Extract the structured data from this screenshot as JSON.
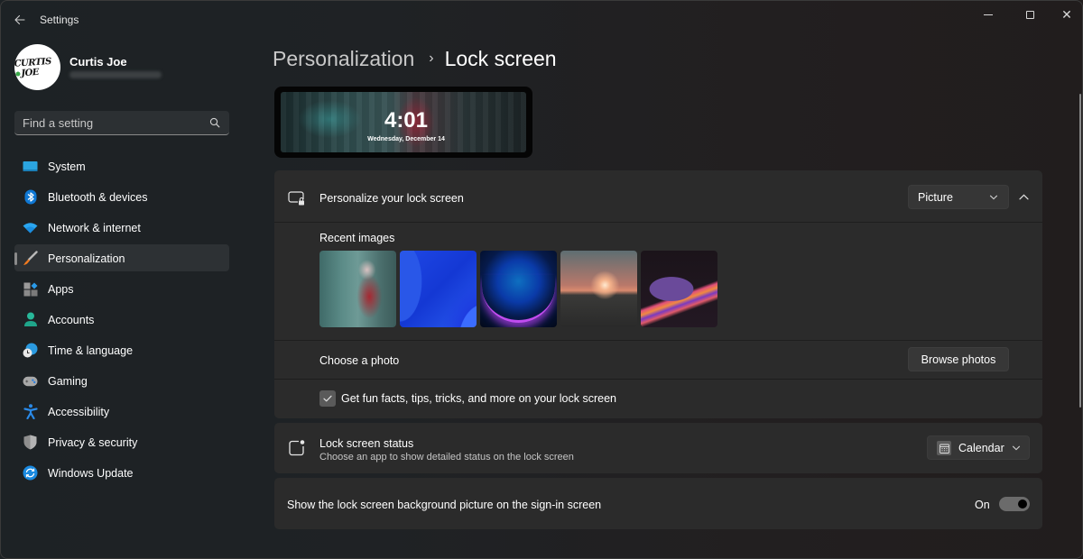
{
  "window": {
    "title": "Settings",
    "controls": {
      "minimize": "minimize",
      "maximize": "maximize",
      "close": "close"
    }
  },
  "profile": {
    "name": "Curtis Joe",
    "avatar_text_left": "CURTIS",
    "avatar_text_right": "JOE"
  },
  "search": {
    "placeholder": "Find a setting",
    "value": ""
  },
  "sidebar": {
    "items": [
      {
        "label": "System",
        "icon": "monitor-icon",
        "active": false
      },
      {
        "label": "Bluetooth & devices",
        "icon": "bluetooth-icon",
        "active": false
      },
      {
        "label": "Network & internet",
        "icon": "wifi-icon",
        "active": false
      },
      {
        "label": "Personalization",
        "icon": "paintbrush-icon",
        "active": true
      },
      {
        "label": "Apps",
        "icon": "apps-icon",
        "active": false
      },
      {
        "label": "Accounts",
        "icon": "person-icon",
        "active": false
      },
      {
        "label": "Time & language",
        "icon": "globe-clock-icon",
        "active": false
      },
      {
        "label": "Gaming",
        "icon": "gamepad-icon",
        "active": false
      },
      {
        "label": "Accessibility",
        "icon": "accessibility-icon",
        "active": false
      },
      {
        "label": "Privacy & security",
        "icon": "shield-icon",
        "active": false
      },
      {
        "label": "Windows Update",
        "icon": "update-icon",
        "active": false
      }
    ]
  },
  "breadcrumb": {
    "parent": "Personalization",
    "separator": "›",
    "current": "Lock screen"
  },
  "preview": {
    "time": "4:01",
    "date": "Wednesday, December 14"
  },
  "personalize_card": {
    "title": "Personalize your lock screen",
    "dropdown_value": "Picture",
    "expanded": true,
    "recent_images_label": "Recent images",
    "recent_images": [
      {
        "name": "anime-city-wallpaper"
      },
      {
        "name": "windows-bloom-blue"
      },
      {
        "name": "blue-orb-glow"
      },
      {
        "name": "sunset-lake"
      },
      {
        "name": "purple-ribbon-swirl"
      }
    ],
    "choose_photo_label": "Choose a photo",
    "browse_button": "Browse photos",
    "fun_facts_label": "Get fun facts, tips, tricks, and more on your lock screen",
    "fun_facts_checked": true
  },
  "status_card": {
    "title": "Lock screen status",
    "subtitle": "Choose an app to show detailed status on the lock screen",
    "dropdown_value": "Calendar"
  },
  "signin_card": {
    "title": "Show the lock screen background picture on the sign-in screen",
    "toggle_label": "On",
    "toggle_on": true
  }
}
